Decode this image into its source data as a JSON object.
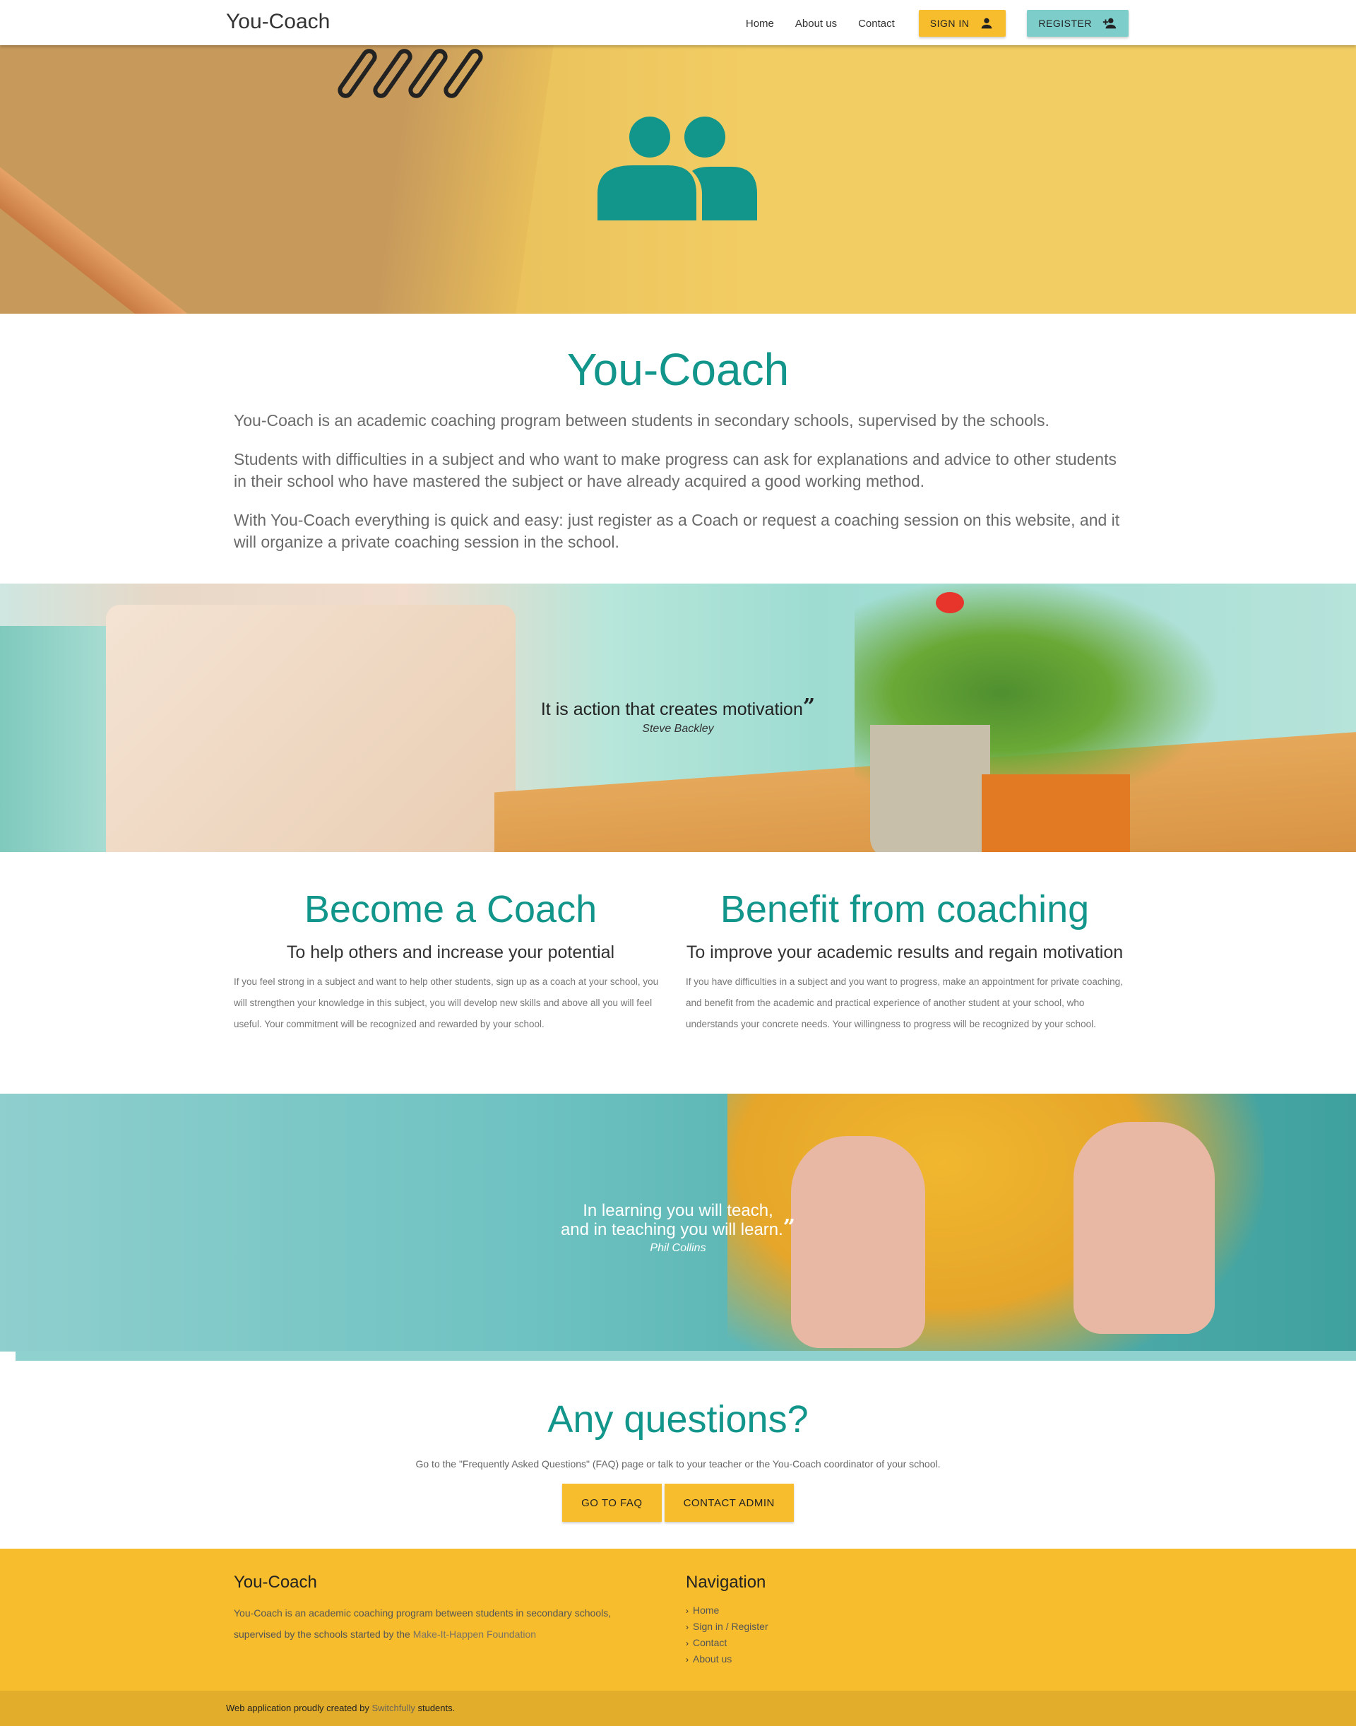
{
  "nav": {
    "brand": "You-Coach",
    "links": [
      "Home",
      "About us",
      "Contact"
    ],
    "signin_label": "SIGN IN",
    "register_label": "REGISTER"
  },
  "intro": {
    "title": "You-Coach",
    "paragraphs": [
      "You-Coach is an academic coaching program between students in secondary schools, supervised by the schools.",
      "Students with difficulties in a subject and who want to make progress can ask for explanations and advice to other students in their school who have mastered the subject or have already acquired a good working method.",
      "With You-Coach everything is quick and easy: just register as a Coach or request a coaching session on this website, and it will organize a private coaching session in the school."
    ]
  },
  "quote1": {
    "text": "It is action that creates motivation",
    "mark": "”",
    "author": "Steve Backley"
  },
  "features": {
    "coach": {
      "title": "Become a Coach",
      "subtitle": "To help others and increase your potential",
      "text": "If you feel strong in a subject and want to help other students, sign up as a coach at your school, you will strengthen your knowledge in this subject, you will develop new skills and above all you will feel useful. Your commitment will be recognized and rewarded by your school."
    },
    "coachee": {
      "title": "Benefit from coaching",
      "subtitle": "To improve your academic results and regain motivation",
      "text": "If you have difficulties in a subject and you want to progress, make an appointment for private coaching, and benefit from the academic and practical experience of another student at your school, who understands your concrete needs. Your willingness to progress will be recognized by your school."
    }
  },
  "quote2": {
    "line1": "In learning you will teach,",
    "line2": "and in teaching you will learn.",
    "mark": "”",
    "author": "Phil Collins"
  },
  "questions": {
    "title": "Any questions?",
    "text": "Go to the \"Frequently Asked Questions\" (FAQ) page or talk to your teacher or the You-Coach coordinator of your school.",
    "faq_button": "GO TO FAQ",
    "contact_button": "CONTACT ADMIN"
  },
  "footer": {
    "title": "You-Coach",
    "desc_start": "You-Coach is an academic coaching program between students in secondary schools, supervised by the schools started by the ",
    "desc_link": "Make-It-Happen Foundation",
    "nav_title": "Navigation",
    "nav_items": [
      "Home",
      "Sign in / Register",
      "Contact",
      "About us"
    ],
    "bottom_start": "Web application proudly created by ",
    "bottom_link": "Switchfully",
    "bottom_end": " students."
  },
  "colors": {
    "teal": "#12958a",
    "yellow": "#f7bd2d",
    "register": "#7dcdcb"
  },
  "icons": [
    "account-icon",
    "add-account-icon",
    "users-icon",
    "chevron-right-icon"
  ]
}
